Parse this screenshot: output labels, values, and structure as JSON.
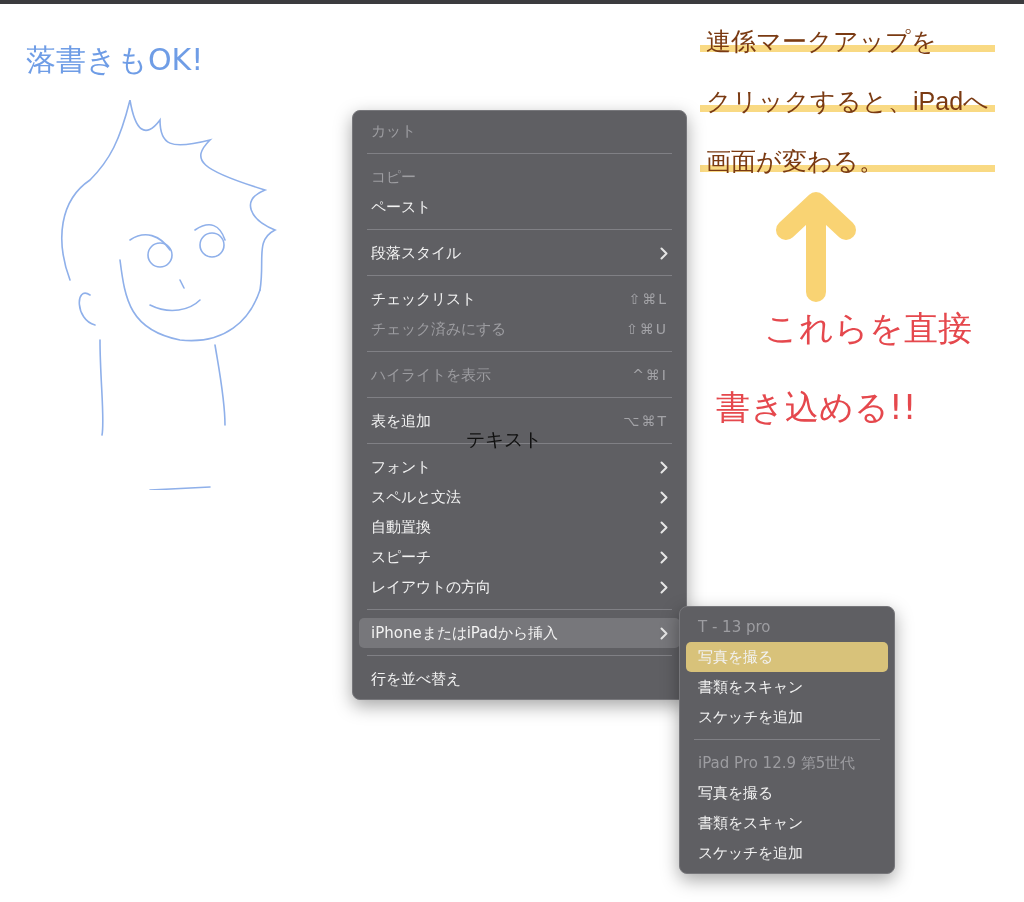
{
  "notes": [
    {
      "kind": "doodle",
      "lines": [
        "落書きもOK!"
      ],
      "color": "#6f9de6"
    },
    {
      "kind": "highlighted",
      "lines": [
        "連係マークアップを",
        "クリックすると、iPadへ",
        "画面が変わる。"
      ],
      "color": "#7a3a12"
    },
    {
      "kind": "plain",
      "lines": [
        "これらを直接",
        "書き込める!!"
      ],
      "color": "#e5484d"
    }
  ],
  "canvas_text": "テキスト",
  "menu": {
    "items": [
      {
        "kind": "item",
        "label": "カット",
        "disabled": true,
        "selected": false
      },
      {
        "kind": "separator"
      },
      {
        "kind": "item",
        "label": "コピー",
        "disabled": true,
        "selected": false
      },
      {
        "kind": "item",
        "label": "ペースト",
        "disabled": false,
        "selected": false
      },
      {
        "kind": "separator"
      },
      {
        "kind": "item",
        "label": "段落スタイル",
        "disabled": false,
        "selected": false,
        "submenu": true
      },
      {
        "kind": "separator"
      },
      {
        "kind": "item",
        "label": "チェックリスト",
        "disabled": false,
        "selected": false,
        "shortcut": "⇧⌘L"
      },
      {
        "kind": "item",
        "label": "チェック済みにする",
        "disabled": true,
        "selected": false,
        "shortcut": "⇧⌘U"
      },
      {
        "kind": "separator"
      },
      {
        "kind": "item",
        "label": "ハイライトを表示",
        "disabled": true,
        "selected": false,
        "shortcut": "^⌘I"
      },
      {
        "kind": "separator"
      },
      {
        "kind": "item",
        "label": "表を追加",
        "disabled": false,
        "selected": false,
        "shortcut": "⌥⌘T"
      },
      {
        "kind": "separator"
      },
      {
        "kind": "item",
        "label": "フォント",
        "disabled": false,
        "selected": false,
        "submenu": true
      },
      {
        "kind": "item",
        "label": "スペルと文法",
        "disabled": false,
        "selected": false,
        "submenu": true
      },
      {
        "kind": "item",
        "label": "自動置換",
        "disabled": false,
        "selected": false,
        "submenu": true
      },
      {
        "kind": "item",
        "label": "スピーチ",
        "disabled": false,
        "selected": false,
        "submenu": true
      },
      {
        "kind": "item",
        "label": "レイアウトの方向",
        "disabled": false,
        "selected": false,
        "submenu": true
      },
      {
        "kind": "separator"
      },
      {
        "kind": "item",
        "label": "iPhoneまたはiPadから挿入",
        "disabled": false,
        "selected": true,
        "submenu": true
      },
      {
        "kind": "separator"
      },
      {
        "kind": "item",
        "label": "行を並べ替え",
        "disabled": false,
        "selected": false
      }
    ]
  },
  "submenu": {
    "items": [
      {
        "kind": "header",
        "label": "T - 13 pro"
      },
      {
        "kind": "item",
        "label": "写真を撮る",
        "selected": true
      },
      {
        "kind": "item",
        "label": "書類をスキャン",
        "selected": false
      },
      {
        "kind": "item",
        "label": "スケッチを追加",
        "selected": false
      },
      {
        "kind": "separator"
      },
      {
        "kind": "header",
        "label": "iPad Pro 12.9 第5世代"
      },
      {
        "kind": "item",
        "label": "写真を撮る",
        "selected": false
      },
      {
        "kind": "item",
        "label": "書類をスキャン",
        "selected": false
      },
      {
        "kind": "item",
        "label": "スケッチを追加",
        "selected": false
      }
    ]
  }
}
